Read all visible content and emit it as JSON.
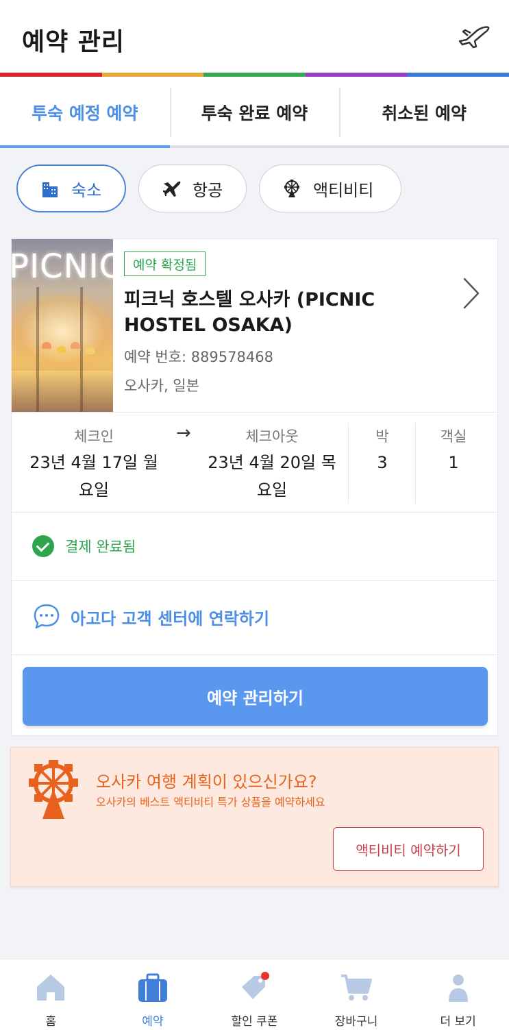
{
  "header": {
    "title": "예약 관리",
    "icon": "airplane-icon"
  },
  "rainbow_colors": [
    "#d9232d",
    "#e6a93a",
    "#35a853",
    "#9b3bc9",
    "#3a7bd5"
  ],
  "tabs": [
    {
      "label": "투숙 예정 예약",
      "active": true
    },
    {
      "label": "투숙 완료 예약",
      "active": false
    },
    {
      "label": "취소된 예약",
      "active": false
    }
  ],
  "filters": [
    {
      "label": "숙소",
      "icon": "hotel-icon",
      "active": true
    },
    {
      "label": "항공",
      "icon": "airplane-icon",
      "active": false
    },
    {
      "label": "액티비티",
      "icon": "ferris-wheel-icon",
      "active": false
    }
  ],
  "booking": {
    "status_badge": "예약 확정됨",
    "hotel_name": "피크닉 호스텔 오사카 (PICNIC HOSTEL OSAKA)",
    "thumb_sign": "PICNIC",
    "booking_number": "예약 번호: 889578468",
    "location": "오사카, 일본",
    "checkin_label": "체크인",
    "checkin_line1": "23년 4월 17일 월",
    "checkin_line2": "요일",
    "arrow": "→",
    "checkout_label": "체크아웃",
    "checkout_line1": "23년 4월 20일 목",
    "checkout_line2": "요일",
    "nights_label": "박",
    "nights_value": "3",
    "rooms_label": "객실",
    "rooms_value": "1",
    "payment_status": "결제 완료됨",
    "contact_label": "아고다 고객 센터에 연락하기",
    "manage_button": "예약 관리하기"
  },
  "promo": {
    "title": "오사카 여행 계획이 있으신가요?",
    "subtitle": "오사카의 베스트 액티비티 특가 상품을 예약하세요",
    "button": "액티비티 예약하기",
    "accent": "#e8621d"
  },
  "bottom_nav": [
    {
      "label": "홈",
      "icon": "home-icon",
      "active": false
    },
    {
      "label": "예약",
      "icon": "briefcase-icon",
      "active": true
    },
    {
      "label": "할인 쿠폰",
      "icon": "coupon-tag-icon",
      "active": false
    },
    {
      "label": "장바구니",
      "icon": "cart-icon",
      "active": false
    },
    {
      "label": "더 보기",
      "icon": "profile-icon",
      "active": false
    }
  ],
  "colors": {
    "primary_blue": "#5a97ee",
    "success_green": "#2ea44f",
    "promo_bg": "#fde9df"
  }
}
